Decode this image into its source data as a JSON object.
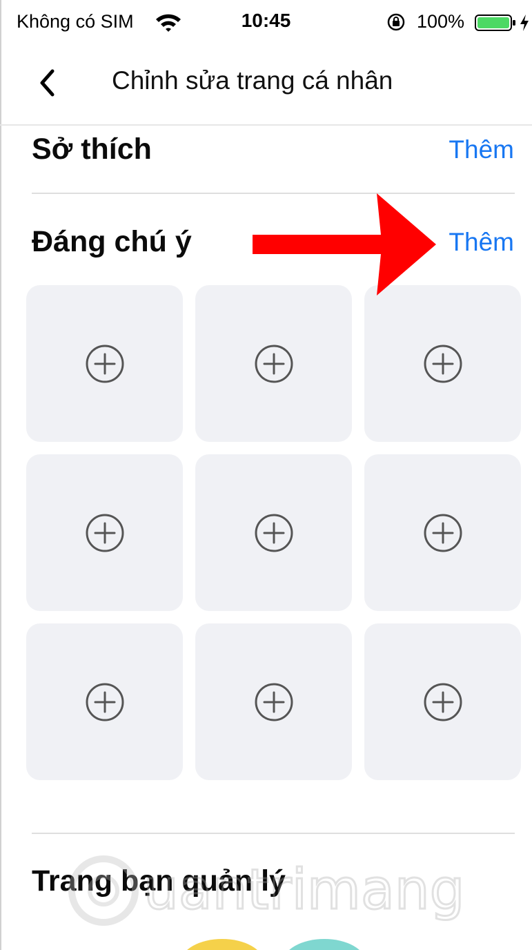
{
  "status_bar": {
    "carrier": "Không có SIM",
    "time": "10:45",
    "battery_percent": "100%",
    "battery_level": 1.0,
    "wifi_icon": "wifi-icon",
    "rotation_lock_icon": "rotation-lock-icon",
    "charging_icon": "bolt-icon"
  },
  "nav": {
    "title": "Chỉnh sửa trang cá nhân",
    "back_icon": "chevron-left-icon"
  },
  "sections": {
    "hobbies": {
      "title": "Sở thích",
      "add_label": "Thêm"
    },
    "featured": {
      "title": "Đáng chú ý",
      "add_label": "Thêm",
      "tile_count": 9,
      "tile_icon": "plus-circle-icon"
    },
    "pages": {
      "title": "Trang bạn quản lý"
    }
  },
  "watermark": {
    "text": "uantrimang"
  },
  "colors": {
    "accent": "#1877f2",
    "tile_bg": "#f0f1f5",
    "annotation_arrow": "#ff0000",
    "icon_gray": "#555555"
  }
}
